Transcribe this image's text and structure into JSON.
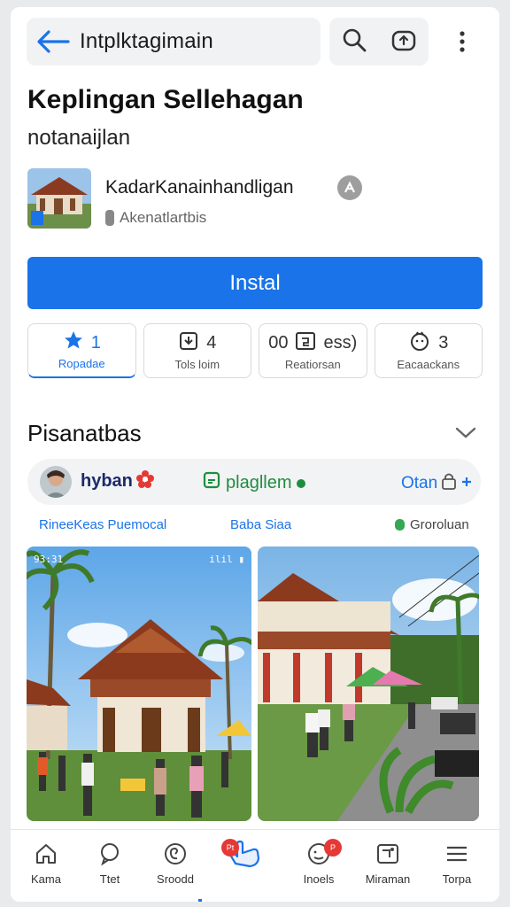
{
  "header": {
    "search_text": "Intplktagimain",
    "icons": [
      "back-arrow-icon",
      "search-icon",
      "share-icon",
      "more-vert-icon"
    ]
  },
  "app": {
    "title": "Keplingan Sellehagan",
    "subtitle": "notanaijlan",
    "developer": "KadarKanainhandligan",
    "developer_meta": "Akenatlartbis",
    "install_label": "Instal"
  },
  "stats": [
    {
      "value": "1",
      "label": "Ropadae",
      "icon": "star-icon"
    },
    {
      "value": "4",
      "label": "Tols loim",
      "icon": "download-icon"
    },
    {
      "value": "ess)",
      "prefix": "00",
      "label": "Reatiorsan",
      "icon": "rating-box-icon"
    },
    {
      "value": "3",
      "label": "Eacaackans",
      "icon": "face-icon"
    }
  ],
  "section": {
    "title": "Pisanatbas"
  },
  "tags": {
    "name": "hyban",
    "green_label": "plagllem",
    "action_label": "Otan"
  },
  "links": {
    "left": "RineeKeas Puemocal",
    "middle": "Baba Siaa",
    "right": "Groroluan"
  },
  "screenshots": [
    {
      "status": "93:31",
      "status_right": "ilil ▮"
    },
    {
      "status": ""
    }
  ],
  "bottom_nav": [
    {
      "label": "Kama",
      "icon": "home-icon"
    },
    {
      "label": "Ttet",
      "icon": "chat-icon"
    },
    {
      "label": "Sroodd",
      "icon": "spiral-icon"
    },
    {
      "label": "",
      "icon": "hand-icon",
      "badge": "Pt"
    },
    {
      "label": "Inoels",
      "icon": "smile-icon",
      "badge": "P"
    },
    {
      "label": "Miraman",
      "icon": "photo-icon"
    },
    {
      "label": "Torpa",
      "icon": "menu-icon"
    }
  ],
  "colors": {
    "accent": "#1a73e8",
    "green": "#1e8e3e",
    "badge": "#e53935"
  }
}
